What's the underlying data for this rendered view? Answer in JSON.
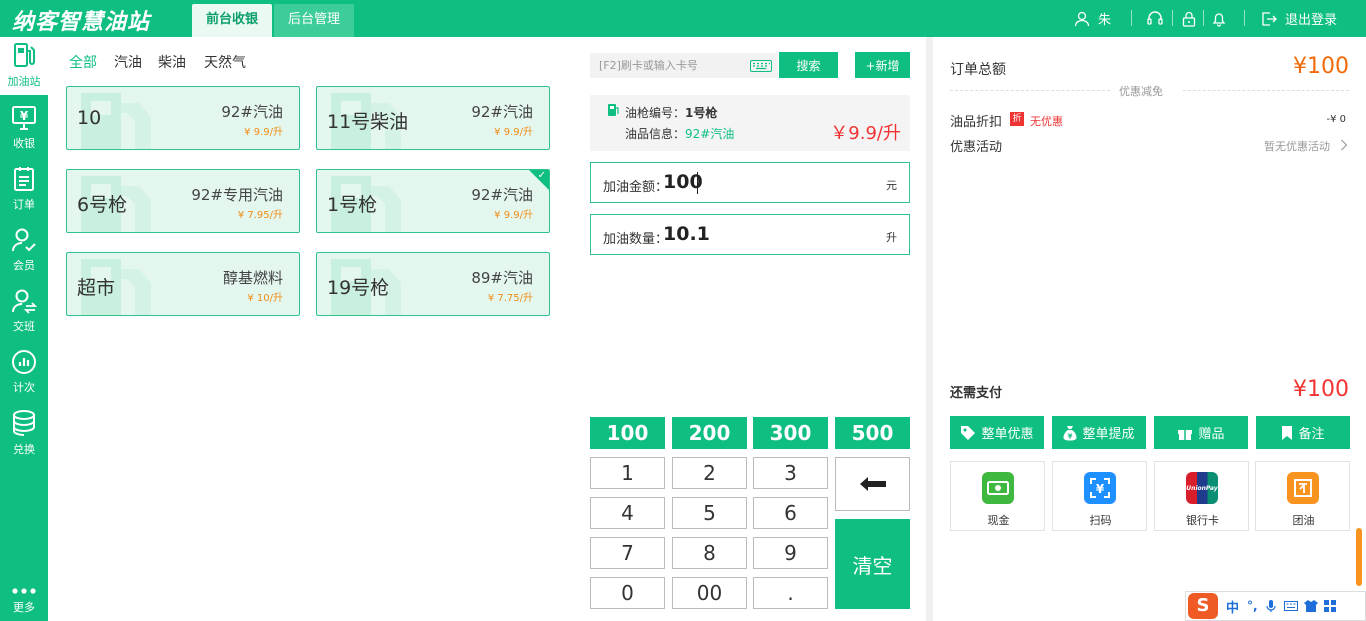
{
  "app": {
    "logo": "纳客智慧油站"
  },
  "top_tabs": [
    {
      "label": "前台收银",
      "active": true
    },
    {
      "label": "后台管理",
      "active": false
    }
  ],
  "user": {
    "name": "朱",
    "logout": "退出登录"
  },
  "sidebar": [
    {
      "label": "加油站",
      "icon": "gas-pump-icon",
      "active": true
    },
    {
      "label": "收银",
      "icon": "cashier-icon"
    },
    {
      "label": "订单",
      "icon": "order-icon"
    },
    {
      "label": "会员",
      "icon": "member-icon"
    },
    {
      "label": "交班",
      "icon": "shift-icon"
    },
    {
      "label": "计次",
      "icon": "count-icon"
    },
    {
      "label": "兑换",
      "icon": "exchange-icon"
    },
    {
      "label": "更多",
      "icon": "more-icon"
    }
  ],
  "fuel_filters": [
    {
      "label": "全部",
      "active": true
    },
    {
      "label": "汽油"
    },
    {
      "label": "柴油"
    },
    {
      "label": "天然气"
    }
  ],
  "nozzles": [
    {
      "name": "10",
      "fuel": "92#汽油",
      "price": "¥ 9.9/升"
    },
    {
      "name": "11号柴油",
      "fuel": "92#汽油",
      "price": "¥ 9.9/升"
    },
    {
      "name": "6号枪",
      "fuel": "92#专用汽油",
      "price": "¥ 7.95/升"
    },
    {
      "name": "1号枪",
      "fuel": "92#汽油",
      "price": "¥ 9.9/升",
      "selected": true
    },
    {
      "name": "超市",
      "fuel": "醇基燃料",
      "price": "¥ 10/升"
    },
    {
      "name": "19号枪",
      "fuel": "89#汽油",
      "price": "¥ 7.75/升"
    }
  ],
  "search": {
    "placeholder": "[F2]刷卡或输入卡号",
    "button": "搜索",
    "add": "+新增"
  },
  "selected_info": {
    "nozzle_label": "油枪编号：",
    "nozzle_value": "1号枪",
    "fuel_label": "油品信息：",
    "fuel_value": "92#汽油",
    "price": "￥9.9/升"
  },
  "amount": {
    "label": "加油金额：",
    "value": "100",
    "unit": "元"
  },
  "quantity": {
    "label": "加油数量：",
    "value": "10.1",
    "unit": "升"
  },
  "quick_amounts": [
    "100",
    "200",
    "300",
    "500"
  ],
  "keypad": [
    "1",
    "2",
    "3",
    "4",
    "5",
    "6",
    "7",
    "8",
    "9",
    "0",
    "00",
    "."
  ],
  "clear_label": "清空",
  "order": {
    "total_label": "订单总额",
    "total_value": "¥100",
    "discount_section": "优惠减免",
    "fuel_discount_label": "油品折扣",
    "discount_badge": "折",
    "discount_text": "无优惠",
    "discount_value": "-¥ 0",
    "promo_label": "优惠活动",
    "promo_value": "暂无优惠活动",
    "due_label": "还需支付",
    "due_value": "¥100"
  },
  "actions": [
    {
      "label": "整单优惠",
      "icon": "tag-icon"
    },
    {
      "label": "整单提成",
      "icon": "money-bag-icon"
    },
    {
      "label": "赠品",
      "icon": "gift-icon"
    },
    {
      "label": "备注",
      "icon": "bookmark-icon"
    }
  ],
  "payments": [
    {
      "label": "现金",
      "icon": "cash-icon",
      "color": "#3fb83f"
    },
    {
      "label": "扫码",
      "icon": "qr-scan-icon",
      "color": "#1e90ff"
    },
    {
      "label": "银行卡",
      "icon": "unionpay-icon",
      "color": "#d81e2a"
    },
    {
      "label": "团油",
      "icon": "group-fuel-icon",
      "color": "#f7931e"
    }
  ],
  "ime": {
    "lang": "中",
    "punct": "°,"
  },
  "colors": {
    "brand": "#0fbf81",
    "price_red": "#f03434",
    "amount_orange": "#f26b0a"
  }
}
